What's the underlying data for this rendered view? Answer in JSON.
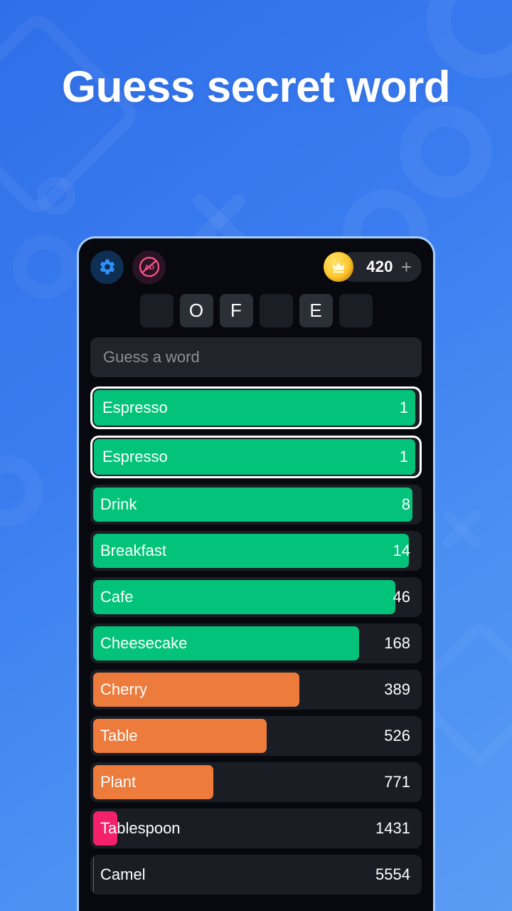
{
  "headline": "Guess secret word",
  "colors": {
    "background_blue": "#3a7cf0",
    "green": "#03c37a",
    "orange": "#ec7b3c",
    "pink": "#f5206a",
    "screen_dark": "#07090f",
    "row_track": "#1a1d23"
  },
  "phone": {
    "topbar": {
      "settings_icon": "gear-icon",
      "no_ads_icon": "no-ads-icon",
      "no_ads_label": "AD",
      "coin_icon": "crown-coin-icon",
      "coin_count": "420",
      "add_coins_label": "+"
    },
    "word_tiles": [
      {
        "letter": "",
        "state": "empty"
      },
      {
        "letter": "O",
        "state": "filled"
      },
      {
        "letter": "F",
        "state": "filled"
      },
      {
        "letter": "",
        "state": "empty"
      },
      {
        "letter": "E",
        "state": "filled"
      },
      {
        "letter": "",
        "state": "empty"
      }
    ],
    "guess_input": {
      "placeholder": "Guess a word",
      "value": ""
    },
    "guesses": [
      {
        "word": "Espresso",
        "rank": "1",
        "color": "green",
        "fill": 100,
        "highlight": true
      },
      {
        "word": "Espresso",
        "rank": "1",
        "color": "green",
        "fill": 100,
        "highlight": true
      },
      {
        "word": "Drink",
        "rank": "8",
        "color": "green",
        "fill": 98,
        "highlight": false
      },
      {
        "word": "Breakfast",
        "rank": "14",
        "color": "green",
        "fill": 97,
        "highlight": false
      },
      {
        "word": "Cafe",
        "rank": "46",
        "color": "green",
        "fill": 93,
        "highlight": false
      },
      {
        "word": "Cheesecake",
        "rank": "168",
        "color": "green",
        "fill": 82,
        "highlight": false
      },
      {
        "word": "Cherry",
        "rank": "389",
        "color": "orange",
        "fill": 64,
        "highlight": false
      },
      {
        "word": "Table",
        "rank": "526",
        "color": "orange",
        "fill": 54,
        "highlight": false
      },
      {
        "word": "Plant",
        "rank": "771",
        "color": "orange",
        "fill": 38,
        "highlight": false
      },
      {
        "word": "Tablespoon",
        "rank": "1431",
        "color": "pink",
        "fill": 9,
        "highlight": false
      },
      {
        "word": "Camel",
        "rank": "5554",
        "color": "pink",
        "fill": 2,
        "highlight": false
      }
    ]
  }
}
